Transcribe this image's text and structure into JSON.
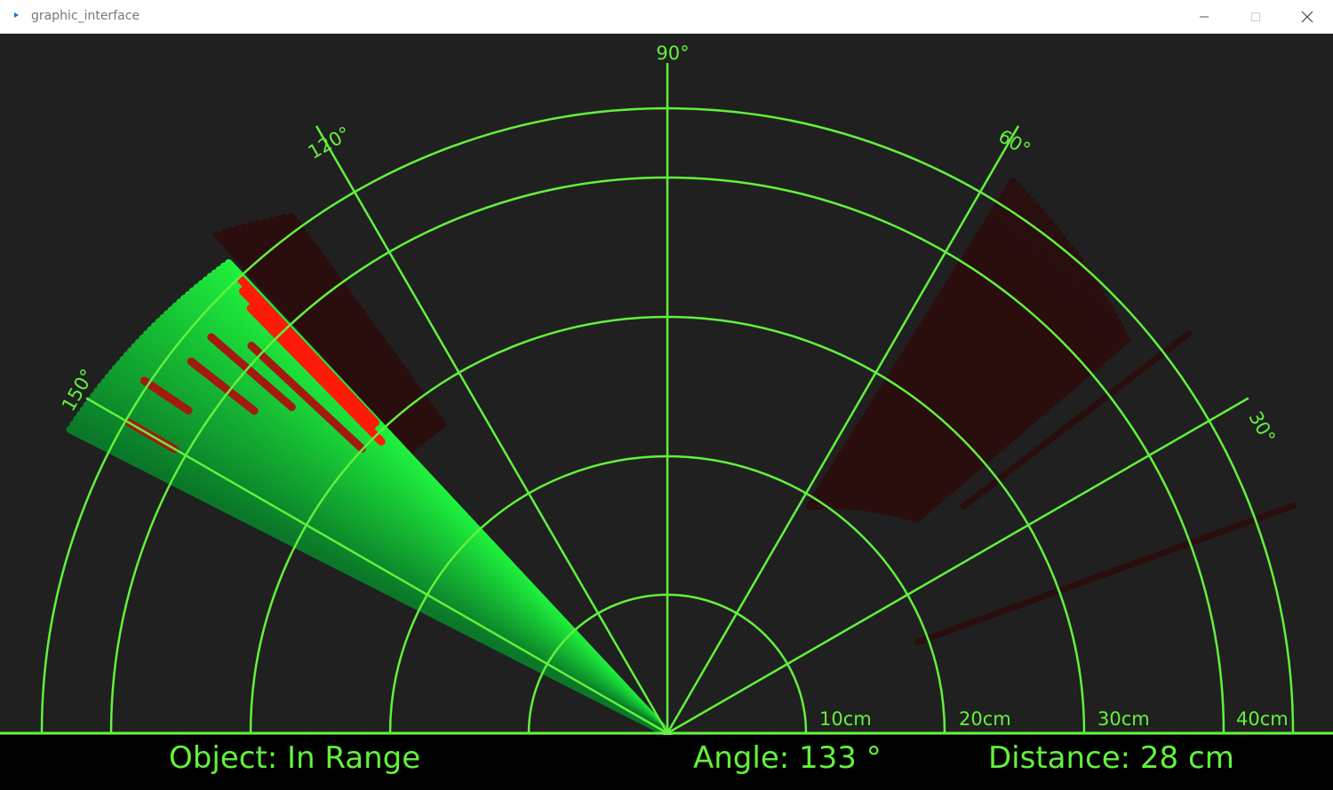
{
  "window": {
    "title": "graphic_interface",
    "controls": [
      "minimize",
      "maximize",
      "close"
    ]
  },
  "radar": {
    "angle_labels": [
      "30°",
      "60°",
      "90°",
      "120°",
      "150°"
    ],
    "distance_labels": [
      "10cm",
      "20cm",
      "30cm",
      "40cm"
    ],
    "sweep_angle_deg": 133
  },
  "status": {
    "object_text": "Object: In Range",
    "angle_text": "Angle: 133 °",
    "distance_text": "Distance: 28 cm"
  },
  "colors": {
    "background": "#202020",
    "grid": "#62f23c",
    "sweep": "#1ef03c",
    "detection": "#ff1a0a",
    "faded_detection": "#2a0d0d",
    "status_bar": "#000000"
  }
}
